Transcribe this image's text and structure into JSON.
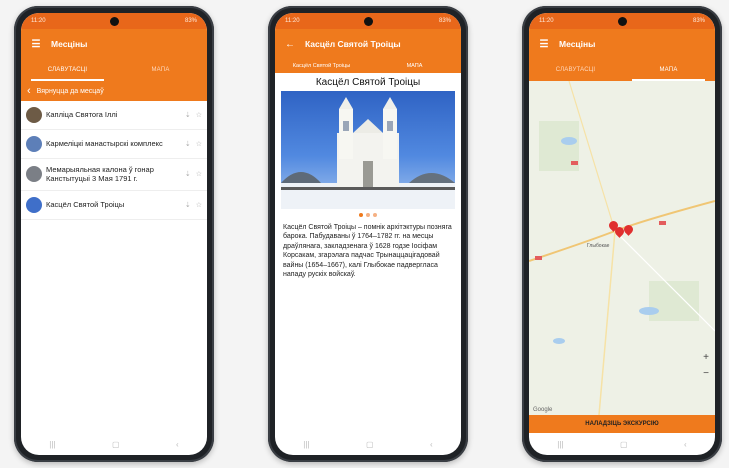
{
  "status": {
    "time": "11:20",
    "battery": "83%"
  },
  "tabs": {
    "sights": "СЛАВУТАСЦІ",
    "map": "МАПА"
  },
  "screen1": {
    "title": "Месціны",
    "back": "Вярнуцца да месцаў",
    "items": [
      {
        "name": "Капліца Святога Іллі"
      },
      {
        "name": "Кармеліцкі манастырскі комплекс"
      },
      {
        "name": "Мемарыяльная калона ў гонар Канстытуцыі 3 Мая 1791 г."
      },
      {
        "name": "Касцёл Святой Троіцы"
      }
    ]
  },
  "screen2": {
    "appbar": "Касцёл Святой Троіцы",
    "heading": "Касцёл Святой Троіцы",
    "description": "Касцёл Святой Троіцы – помнік архітэктуры позняга барока. Пабудаваны ў 1764–1782 гг. на месцы драўлянага, закладзенага ў 1628 годзе Іосіфам Корсакам, згарэлага падчас Трынаццацігадовай вайны (1654–1667), калі Глыбокае падвергласа нападу рускіх войскаў."
  },
  "screen3": {
    "title": "Месціны",
    "map_label": "Глыбокае",
    "google": "Google",
    "cta": "НАЛАДЗІЦЬ ЭКСКУРСІЮ"
  },
  "colors": {
    "accent": "#ef7a1d",
    "status": "#e8671a",
    "pin": "#e02f2f"
  }
}
